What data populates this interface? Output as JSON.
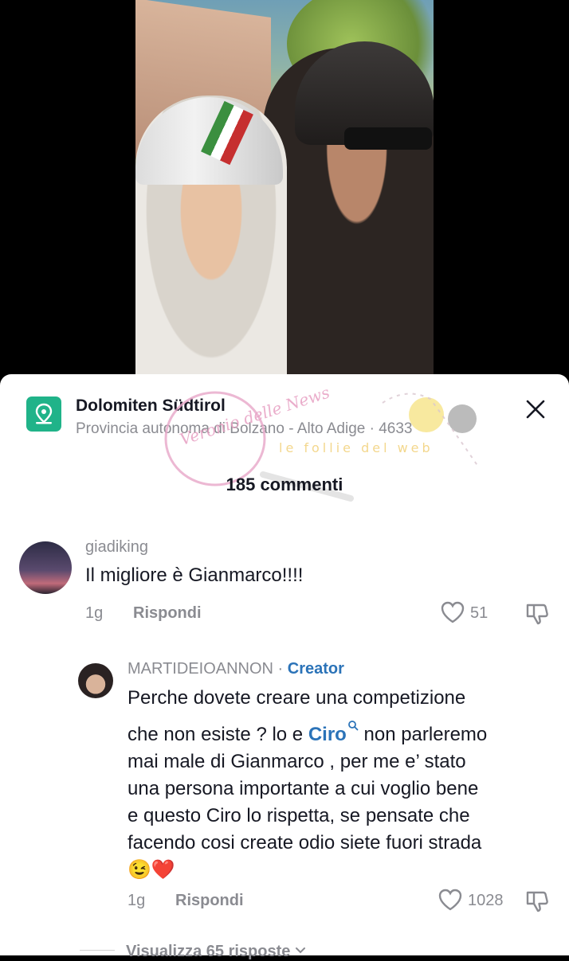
{
  "location": {
    "title": "Dolomiten Südtirol",
    "subtitle": "Provincia autonoma di Bolzano - Alto Adige · 4633"
  },
  "comments_header": "185 commenti",
  "watermark": {
    "text1": "Veronio delle News",
    "text2": "le follie del web"
  },
  "comments": [
    {
      "username": "giadiking",
      "text": "Il migliore è Gianmarco!!!!",
      "time": "1g",
      "reply_label": "Rispondi",
      "likes": "51"
    },
    {
      "username": "MARTIDEIOANNON",
      "separator": " · ",
      "badge": "Creator",
      "text_lines": [
        "Perche dovete creare una competizione",
        "che non esiste ? lo e ",
        " non parleremo",
        "mai male di Gianmarco , per me e’ stato",
        "una persona importante a cui voglio bene",
        "e questo Ciro lo rispetta, se pensate che",
        "facendo cosi create odio siete fuori strada",
        "😉❤️"
      ],
      "mention": "Ciro",
      "time": "1g",
      "reply_label": "Rispondi",
      "likes": "1028"
    }
  ],
  "view_replies": "Visualizza 65 risposte",
  "colors": {
    "accent": "#2b73b8",
    "location_icon": "#20b389",
    "text": "#161823",
    "muted": "#8a8b91"
  }
}
